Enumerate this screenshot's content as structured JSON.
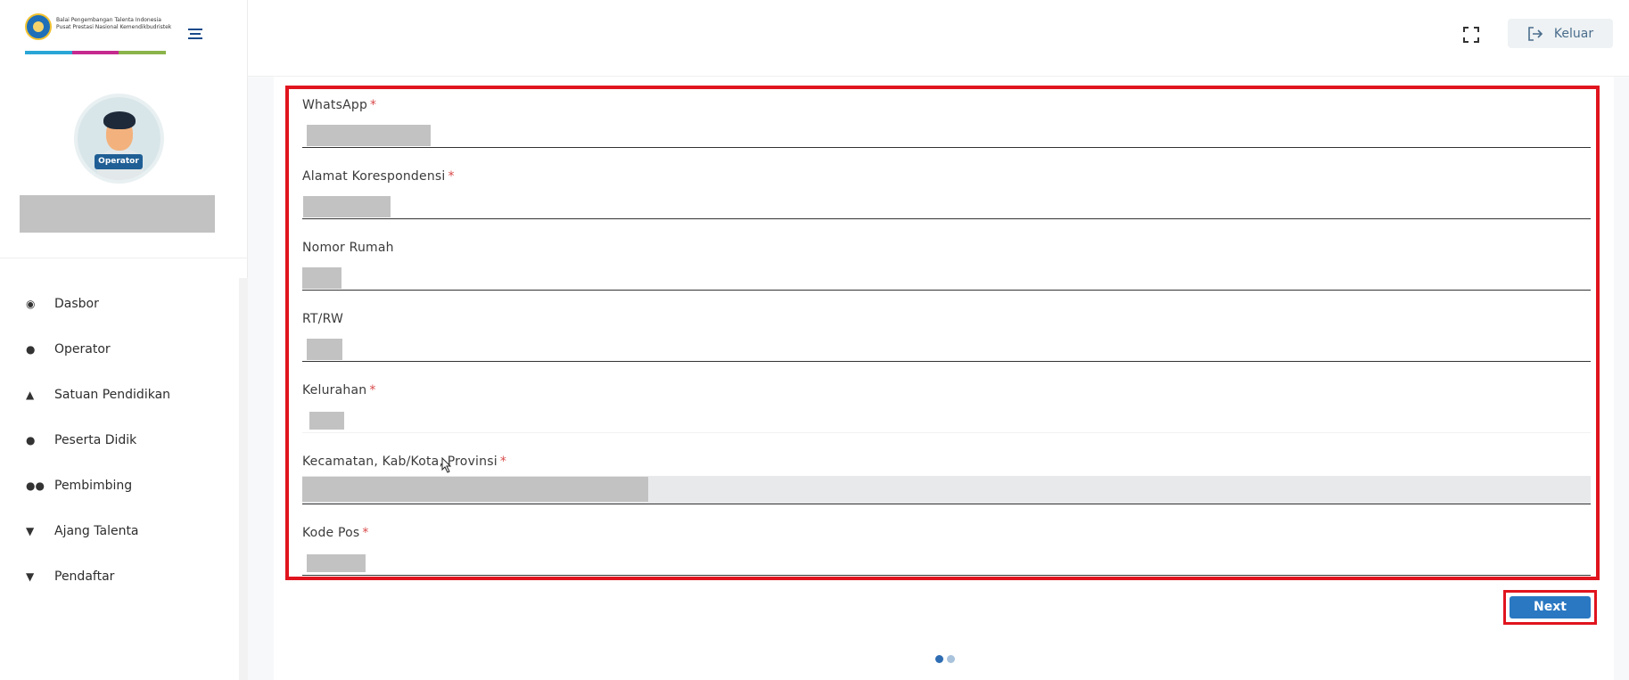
{
  "brand": {
    "logo_text": "Balai Pengembangan Talenta Indonesia Pusat Prestasi Nasional Kemendikbudristek",
    "bar_colors": [
      "#2aa6d6",
      "#c52a8e",
      "#8bb44a"
    ]
  },
  "user": {
    "role_badge": "Operator"
  },
  "sidebar": {
    "items": [
      {
        "label": "Dasbor",
        "icon": "dashboard-icon",
        "glyph": "◉"
      },
      {
        "label": "Operator",
        "icon": "user-icon",
        "glyph": "●"
      },
      {
        "label": "Satuan Pendidikan",
        "icon": "graduation-cap-icon",
        "glyph": "▲"
      },
      {
        "label": "Peserta Didik",
        "icon": "user-icon",
        "glyph": "●"
      },
      {
        "label": "Pembimbing",
        "icon": "users-icon",
        "glyph": "●●"
      },
      {
        "label": "Ajang Talenta",
        "icon": "trophy-icon",
        "glyph": "▼"
      },
      {
        "label": "Pendaftar",
        "icon": "trophy-icon",
        "glyph": "▼"
      }
    ]
  },
  "topbar": {
    "logout_label": "Keluar"
  },
  "form": {
    "fields": [
      {
        "label": "WhatsApp",
        "required": "*"
      },
      {
        "label": "Alamat Korespondensi",
        "required": "*"
      },
      {
        "label": "Nomor Rumah",
        "required": ""
      },
      {
        "label": "RT/RW",
        "required": ""
      },
      {
        "label": "Kelurahan",
        "required": "*"
      },
      {
        "label": "Kecamatan, Kab/Kota, Provinsi",
        "required": "*"
      },
      {
        "label": "Kode Pos",
        "required": "*"
      }
    ],
    "next_label": "Next"
  },
  "pagination": {
    "total": 2,
    "current": 1
  },
  "colors": {
    "primary": "#2a78c2",
    "highlight": "#e0141e",
    "dot_active": "#2f6db3",
    "dot_inactive": "#a9c3dc"
  }
}
